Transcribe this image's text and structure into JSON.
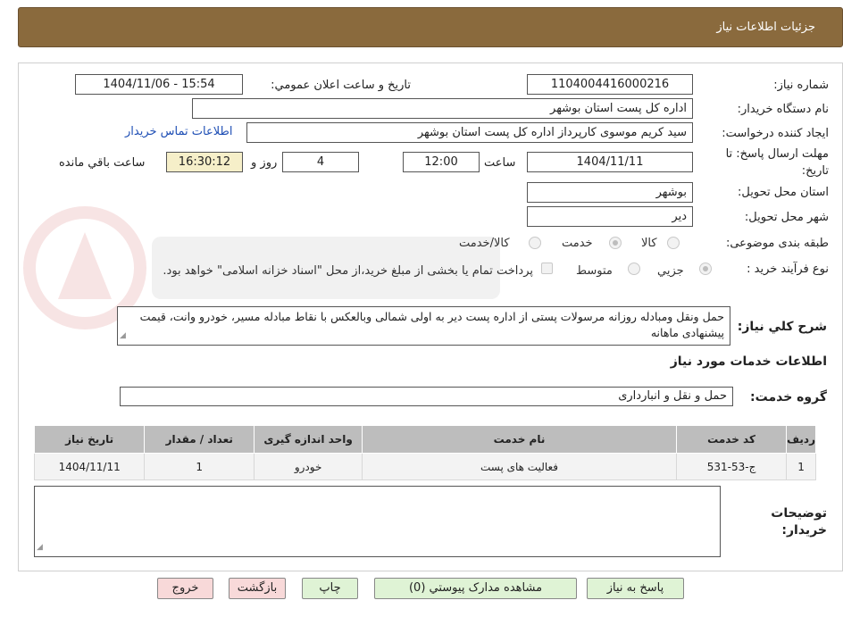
{
  "header": {
    "title": "جزئیات اطلاعات نیاز"
  },
  "fields": {
    "need_number_label": "شماره نیاز:",
    "need_number": "1104004416000216",
    "announce_label": "تاریخ و ساعت اعلان عمومي:",
    "announce_value": "1404/11/06 - 15:54",
    "buyer_org_label": "نام دستگاه خریدار:",
    "buyer_org": "اداره کل پست استان بوشهر",
    "requester_label": "ایجاد کننده درخواست:",
    "requester": "سید کریم موسوی کارپرداز اداره کل پست استان بوشهر",
    "contact_link": "اطلاعات تماس خریدار",
    "deadline_label": "مهلت ارسال پاسخ: تا تاریخ:",
    "deadline_date": "1404/11/11",
    "time_label": "ساعت",
    "deadline_time": "12:00",
    "days_value": "4",
    "days_label": "روز و",
    "remaining_time": "16:30:12",
    "remaining_label": "ساعت باقي مانده",
    "province_label": "استان محل تحویل:",
    "province": "بوشهر",
    "city_label": "شهر محل تحویل:",
    "city": "دیر",
    "category_label": "طبقه بندی موضوعی:",
    "category_options": [
      "کالا",
      "خدمت",
      "کالا/خدمت"
    ],
    "category_selected": "خدمت",
    "process_label": "نوع فرآیند خرید :",
    "process_options": [
      "جزيي",
      "متوسط"
    ],
    "payment_note": "پرداخت تمام یا بخشی از مبلغ خرید،از محل \"اسناد خزانه اسلامی\" خواهد بود."
  },
  "description": {
    "label": "شرح کلي نیاز:",
    "text": "حمل  ونقل ومبادله روزانه مرسولات پستی از اداره پست دیر به اولی شمالی وبالعکس با نقاط مبادله مسیر، خودرو وانت، قیمت پیشنهادی ماهانه"
  },
  "services": {
    "section_title": "اطلاعات خدمات مورد نیاز",
    "group_label": "گروه خدمت:",
    "group_value": "حمل و نقل و انبارداری",
    "columns": [
      "ردیف",
      "کد خدمت",
      "نام خدمت",
      "واحد اندازه گیری",
      "تعداد / مقدار",
      "تاریخ نیاز"
    ],
    "rows": [
      {
        "row": "1",
        "code": "ج-53-531",
        "name": "فعالیت های پست",
        "unit": "خودرو",
        "qty": "1",
        "date": "1404/11/11"
      }
    ]
  },
  "buyer_notes": {
    "label": "توضیحات خریدار:",
    "text": ""
  },
  "buttons": {
    "reply": "پاسخ به نیاز",
    "attachments": "مشاهده مدارک پیوستي (0)",
    "print": "چاپ",
    "back": "بازگشت",
    "exit": "خروج"
  },
  "colors": {
    "header_bg": "#8a6a3d",
    "link": "#1f4fb5",
    "btn_green": "#dff3d5",
    "btn_pink": "#f8d9d9",
    "remaining_bg": "#f6efc9"
  }
}
